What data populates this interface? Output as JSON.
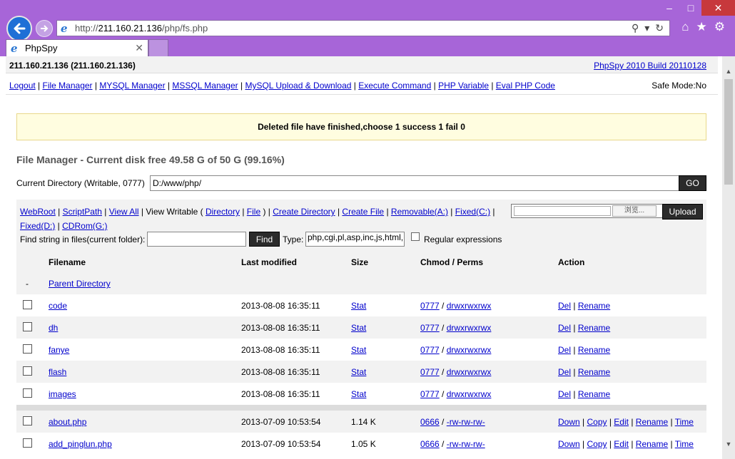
{
  "browser": {
    "url_prefix": "http://",
    "url_host": "211.160.21.136",
    "url_path": "/php/fs.php",
    "tab_title": "PhpSpy"
  },
  "header": {
    "host": "211.160.21.136 (211.160.21.136)",
    "build": "PhpSpy 2010 Build 20110128"
  },
  "menu": {
    "items": [
      "Logout",
      "File Manager",
      "MYSQL Manager",
      "MSSQL Manager",
      "MySQL Upload & Download",
      "Execute Command",
      "PHP Variable",
      "Eval PHP Code"
    ],
    "safe_mode": "Safe Mode:No"
  },
  "notice": "Deleted file have finished,choose 1 success 1 fail 0",
  "file_manager": {
    "title": "File Manager - Current disk free 49.58 G of 50 G (99.16%)",
    "curdir_label": "Current Directory (Writable, 0777)",
    "curdir_value": "D:/www/php/",
    "go_label": "GO"
  },
  "tools": {
    "webroot": "WebRoot",
    "scriptpath": "ScriptPath",
    "view_all": "View All",
    "view_writable": "View Writable (",
    "directory": "Directory",
    "file": "File",
    "close_paren": ")",
    "create_directory": "Create Directory",
    "create_file": "Create File",
    "removable": "Removable(A:)",
    "fixed_c": "Fixed(C:)",
    "fixed_d": "Fixed(D:)",
    "cdrom": "CDRom(G:)",
    "browse_label": "浏览...",
    "upload_label": "Upload",
    "find_label": "Find string in files(current folder):",
    "find_btn": "Find",
    "type_label": "Type:",
    "type_value": "php,cgi,pl,asp,inc,js,html,",
    "regex_label": "Regular expressions"
  },
  "table": {
    "headers": {
      "filename": "Filename",
      "modified": "Last modified",
      "size": "Size",
      "perms": "Chmod / Perms",
      "action": "Action"
    },
    "parent": {
      "dash": "-",
      "label": "Parent Directory"
    },
    "dirs": [
      {
        "name": "code",
        "modified": "2013-08-08 16:35:11",
        "size": "Stat",
        "chmod": "0777",
        "perms": "drwxrwxrwx"
      },
      {
        "name": "dh",
        "modified": "2013-08-08 16:35:11",
        "size": "Stat",
        "chmod": "0777",
        "perms": "drwxrwxrwx"
      },
      {
        "name": "fanye",
        "modified": "2013-08-08 16:35:11",
        "size": "Stat",
        "chmod": "0777",
        "perms": "drwxrwxrwx"
      },
      {
        "name": "flash",
        "modified": "2013-08-08 16:35:11",
        "size": "Stat",
        "chmod": "0777",
        "perms": "drwxrwxrwx"
      },
      {
        "name": "images",
        "modified": "2013-08-08 16:35:11",
        "size": "Stat",
        "chmod": "0777",
        "perms": "drwxrwxrwx"
      }
    ],
    "dir_actions": {
      "del": "Del",
      "rename": "Rename"
    },
    "files": [
      {
        "name": "about.php",
        "modified": "2013-07-09 10:53:54",
        "size": "1.14 K",
        "chmod": "0666",
        "perms": "-rw-rw-rw-"
      },
      {
        "name": "add_pinglun.php",
        "modified": "2013-07-09 10:53:54",
        "size": "1.05 K",
        "chmod": "0666",
        "perms": "-rw-rw-rw-"
      }
    ],
    "file_actions": {
      "down": "Down",
      "copy": "Copy",
      "edit": "Edit",
      "rename": "Rename",
      "time": "Time"
    }
  }
}
